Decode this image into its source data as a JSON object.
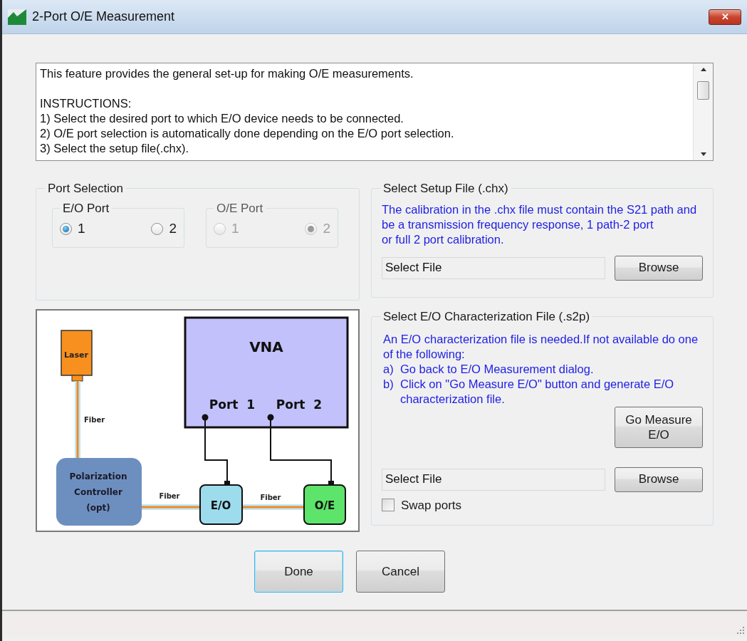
{
  "window": {
    "title": "2-Port O/E Measurement",
    "close": "✕"
  },
  "intro": "This feature provides the general set-up for making O/E measurements.",
  "instructions": [
    "INSTRUCTIONS:",
    "1) Select the desired port to which E/O device needs to be connected.",
    "2) O/E port selection is automatically done depending on the E/O port selection.",
    "3) Select the setup file(.chx)."
  ],
  "port_selection": {
    "title": "Port Selection",
    "groups": [
      {
        "title": "E/O Port",
        "disabled": false,
        "options": [
          {
            "label": "1",
            "selected": true
          },
          {
            "label": "2",
            "selected": false
          }
        ]
      },
      {
        "title": "O/E Port",
        "disabled": true,
        "options": [
          {
            "label": "1",
            "selected": false
          },
          {
            "label": "2",
            "selected": true
          }
        ]
      }
    ]
  },
  "diagram": {
    "laser": "Laser",
    "vna": "VNA",
    "port_1": "Port  1",
    "port_2": "Port  2",
    "controller": [
      "Polarization",
      "Controller",
      "(opt)"
    ],
    "eo": "E/O",
    "oe": "O/E",
    "fiber_labels": [
      "Fiber",
      "Fiber",
      "Fiber"
    ]
  },
  "setup_file": {
    "title": "Select Setup File (.chx)",
    "note": [
      "The calibration in the .chx file must contain the S21 path and",
      "be a transmission frequency response, 1 path-2 port",
      "or full 2 port calibration."
    ],
    "field": "Select File",
    "button": "Browse"
  },
  "eo_file": {
    "title": "Select E/O Characterization File (.s2p)",
    "note": [
      "An E/O characterization file is needed.If not available do one",
      "of the following:"
    ],
    "steps": [
      {
        "marker": "a)",
        "text": "Go back to E/O Measurement dialog."
      },
      {
        "marker": "b)",
        "text": "Click on \"Go Measure E/O\" button and generate E/O characterization file."
      }
    ],
    "measure_button": [
      "Go Measure",
      "E/O"
    ],
    "field": "Select File",
    "button": "Browse",
    "swap": {
      "label": "Swap ports",
      "checked": false
    }
  },
  "buttons": [
    {
      "label": "Done",
      "focused": true
    },
    {
      "label": "Cancel",
      "focused": false
    }
  ]
}
